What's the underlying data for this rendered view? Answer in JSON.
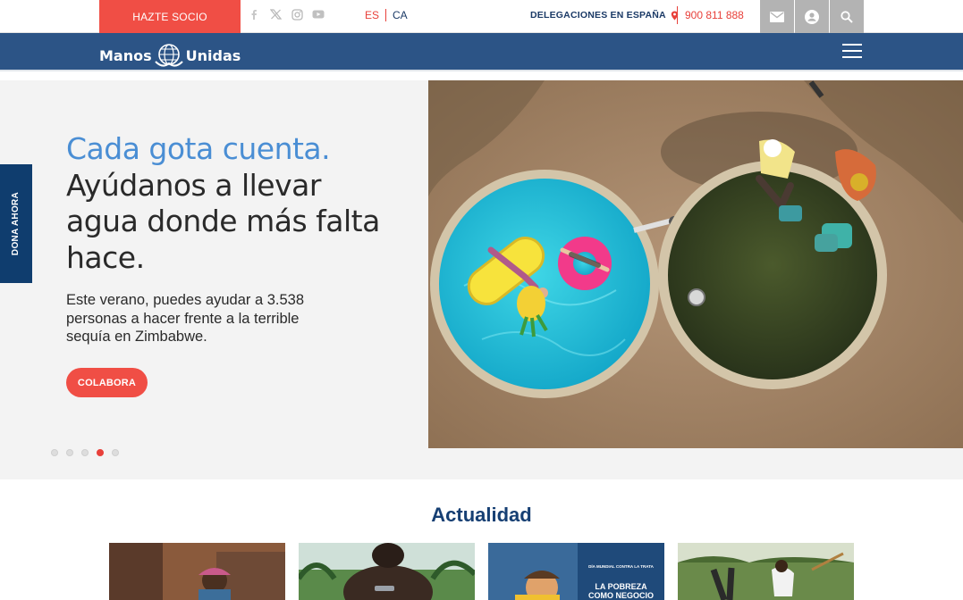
{
  "topbar": {
    "hazte_socio": "HAZTE SOCIO",
    "social_icons": [
      "facebook-icon",
      "x-icon",
      "instagram-icon",
      "youtube-icon"
    ],
    "lang_es": "ES",
    "lang_ca": "CA",
    "delegaciones": "DELEGACIONES EN ESPAÑA",
    "phone": "900 811 888",
    "buttons": [
      "mail-icon",
      "user-icon",
      "search-icon"
    ]
  },
  "navbar": {
    "logo_left": "Manos",
    "logo_right": "Unidas"
  },
  "side_tab": {
    "label": "DONA AHORA"
  },
  "hero": {
    "headline_highlight": "Cada gota cuenta.",
    "headline_rest": "Ayúdanos a llevar agua donde más falta hace.",
    "description": "Este verano, puedes ayudar a 3.538 personas a hacer frente a la terrible sequía en Zimbabwe.",
    "cta": "COLABORA",
    "slides_total": 5,
    "active_slide": 4
  },
  "news": {
    "title": "Actualidad",
    "card3_tag": "DÍA MUNDIAL CONTRA LA TRATA",
    "card3_text_1": "LA POBREZA",
    "card3_text_2": "COMO NEGOCIO"
  },
  "colors": {
    "accent_red": "#f04e45",
    "navy": "#2c5486",
    "highlight_blue": "#4a8ed4",
    "heading_navy": "#163f73"
  }
}
